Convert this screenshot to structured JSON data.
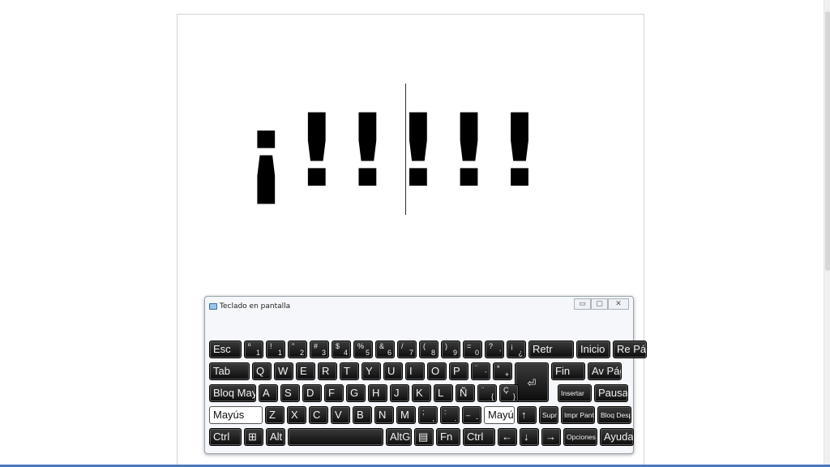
{
  "document": {
    "text": "¡!!!!!"
  },
  "osk": {
    "title": "Teclado en pantalla",
    "minimize_glyph": "▭",
    "maximize_glyph": "▢",
    "close_glyph": "✕",
    "rows": [
      [
        {
          "id": "esc",
          "label": "Esc"
        },
        {
          "id": "key-1",
          "top": "º",
          "label": "1",
          "sub": "\\"
        },
        {
          "id": "key-2",
          "top": "!",
          "label": "1",
          "sub": "|"
        },
        {
          "id": "key-3",
          "top": "\"",
          "label": "2",
          "sub": "@"
        },
        {
          "id": "key-4",
          "top": "#",
          "label": "3",
          "sub": "#"
        },
        {
          "id": "key-5",
          "top": "$",
          "label": "4",
          "sub": "~"
        },
        {
          "id": "key-6",
          "top": "%",
          "label": "5",
          "sub": "€"
        },
        {
          "id": "key-7",
          "top": "&",
          "label": "6",
          "sub": "¬"
        },
        {
          "id": "key-8",
          "top": "/",
          "label": "7",
          "sub": ""
        },
        {
          "id": "key-9",
          "top": "(",
          "label": "8",
          "sub": ""
        },
        {
          "id": "key-10",
          "top": ")",
          "label": "9",
          "sub": ""
        },
        {
          "id": "key-11",
          "top": "=",
          "label": "0",
          "sub": ""
        },
        {
          "id": "key-12",
          "top": "?",
          "label": "'",
          "sub": ""
        },
        {
          "id": "key-13",
          "top": "¡",
          "label": "¿",
          "sub": ""
        },
        {
          "id": "retr",
          "label": "Retr"
        },
        {
          "id": "inicio",
          "label": "Inicio"
        },
        {
          "id": "re-pag",
          "label": "Re Pág"
        }
      ],
      [
        {
          "id": "tab",
          "label": "Tab"
        },
        {
          "id": "q",
          "label": "Q"
        },
        {
          "id": "w",
          "label": "W"
        },
        {
          "id": "e",
          "label": "E"
        },
        {
          "id": "r",
          "label": "R"
        },
        {
          "id": "t",
          "label": "T"
        },
        {
          "id": "y",
          "label": "Y"
        },
        {
          "id": "u",
          "label": "U"
        },
        {
          "id": "i",
          "label": "I"
        },
        {
          "id": "o",
          "label": "O"
        },
        {
          "id": "p",
          "label": "P"
        },
        {
          "id": "acute",
          "top": "¨",
          "label": "`",
          "sub": "["
        },
        {
          "id": "plus",
          "top": "*",
          "label": "+",
          "sub": "]"
        },
        {
          "id": "fin",
          "label": "Fin"
        },
        {
          "id": "av-pag",
          "label": "Av Pág"
        }
      ],
      [
        {
          "id": "bloq-may",
          "label": "Bloq May"
        },
        {
          "id": "a",
          "label": "A"
        },
        {
          "id": "s",
          "label": "S"
        },
        {
          "id": "d",
          "label": "D"
        },
        {
          "id": "f",
          "label": "F"
        },
        {
          "id": "g",
          "label": "G"
        },
        {
          "id": "h",
          "label": "H"
        },
        {
          "id": "j",
          "label": "J"
        },
        {
          "id": "k",
          "label": "K"
        },
        {
          "id": "l",
          "label": "L"
        },
        {
          "id": "n-tilde",
          "label": "Ñ"
        },
        {
          "id": "brace-open",
          "top": "¨",
          "label": "{",
          "sub": ""
        },
        {
          "id": "brace-close",
          "top": "Ç",
          "label": "}",
          "sub": ""
        },
        {
          "id": "insertar",
          "label": "Insertar"
        },
        {
          "id": "pausa",
          "label": "Pausa"
        }
      ],
      [
        {
          "id": "mayus-left",
          "label": "Mayús"
        },
        {
          "id": "z",
          "label": "Z"
        },
        {
          "id": "x",
          "label": "X"
        },
        {
          "id": "c",
          "label": "C"
        },
        {
          "id": "v",
          "label": "V"
        },
        {
          "id": "b",
          "label": "B"
        },
        {
          "id": "n",
          "label": "N"
        },
        {
          "id": "m",
          "label": "M"
        },
        {
          "id": "comma",
          "top": ";",
          "label": ",",
          "sub": ""
        },
        {
          "id": "period",
          "top": ":",
          "label": ".",
          "sub": ""
        },
        {
          "id": "dash",
          "top": "_",
          "label": "-",
          "sub": ""
        },
        {
          "id": "mayus-right",
          "label": "Mayús"
        },
        {
          "id": "arrow-up",
          "label": "↑"
        },
        {
          "id": "supr",
          "label": "Supr"
        },
        {
          "id": "impr-pant",
          "label": "Impr Pant"
        },
        {
          "id": "bloq-despl",
          "label": "Bloq Despl"
        }
      ],
      [
        {
          "id": "ctrl-left",
          "label": "Ctrl"
        },
        {
          "id": "win",
          "label": "⊞"
        },
        {
          "id": "alt",
          "label": "Alt"
        },
        {
          "id": "space",
          "label": ""
        },
        {
          "id": "altgr",
          "label": "AltGr"
        },
        {
          "id": "menu",
          "label": "▤"
        },
        {
          "id": "fn",
          "label": "Fn"
        },
        {
          "id": "ctrl-right",
          "label": "Ctrl"
        },
        {
          "id": "arrow-left",
          "label": "←"
        },
        {
          "id": "arrow-down",
          "label": "↓"
        },
        {
          "id": "arrow-right",
          "label": "→"
        },
        {
          "id": "opciones",
          "label": "Opciones"
        },
        {
          "id": "ayuda",
          "label": "Ayuda"
        }
      ]
    ],
    "enter_glyph": "⏎"
  },
  "colors": {
    "key_bg": "#1a1a1a",
    "key_text": "#f2f2f2",
    "shift_key_bg": "#ffffff",
    "taskbar_line": "#4a79b8"
  }
}
